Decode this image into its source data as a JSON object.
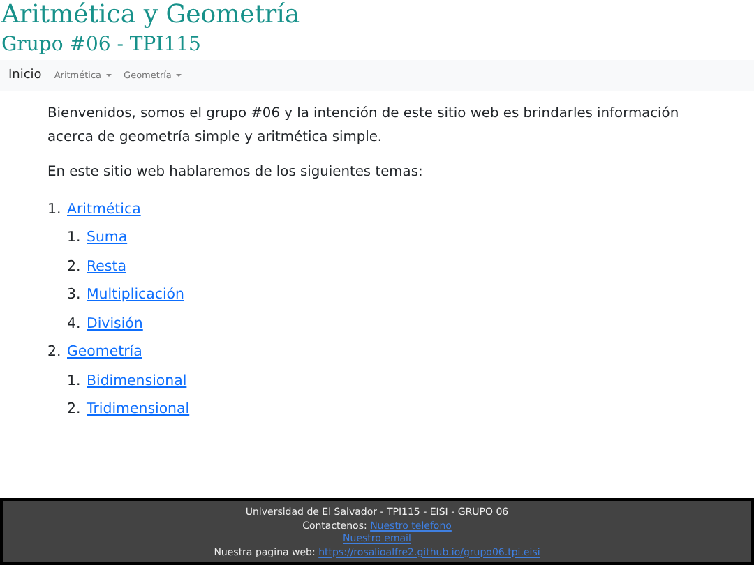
{
  "header": {
    "title": "Aritmética y Geometría",
    "subtitle": "Grupo #06 - TPI115"
  },
  "navbar": {
    "items": [
      {
        "label": "Inicio",
        "kind": "link",
        "selected": true
      },
      {
        "label": "Aritmética",
        "kind": "dropdown",
        "selected": false
      },
      {
        "label": "Geometría",
        "kind": "dropdown",
        "selected": false
      }
    ]
  },
  "content": {
    "intro": "Bienvenidos, somos el grupo #06 y la intención de este sitio web es brindarles información acerca de geometría simple y aritmética simple.",
    "lead": "En este sitio web hablaremos de los siguientes temas:",
    "topics": [
      {
        "number": "1.",
        "label": "Aritmética",
        "children": [
          {
            "number": "1.",
            "label": "Suma"
          },
          {
            "number": "2.",
            "label": "Resta"
          },
          {
            "number": "3.",
            "label": "Multiplicación"
          },
          {
            "number": "4.",
            "label": "División"
          }
        ]
      },
      {
        "number": "2.",
        "label": "Geometría",
        "children": [
          {
            "number": "1.",
            "label": "Bidimensional"
          },
          {
            "number": "2.",
            "label": "Tridimensional"
          }
        ]
      }
    ]
  },
  "footer": {
    "line": "Universidad de El Salvador - TPI115 - EISI - GRUPO 06",
    "contact_label": "Contactenos:",
    "phone_link": "Nuestro telefono",
    "email_link": "Nuestro email",
    "web_label": "Nuestra pagina web:",
    "web_link": "https://rosalioalfre2.github.io/grupo06.tpi.eisi"
  }
}
